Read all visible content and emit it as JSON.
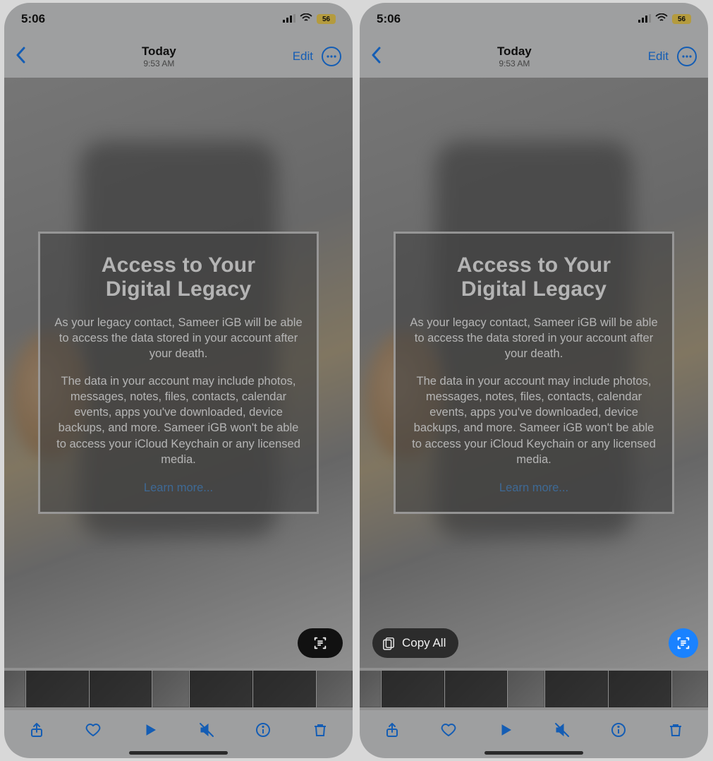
{
  "status": {
    "time": "5:06",
    "battery": "56"
  },
  "nav": {
    "day": "Today",
    "time": "9:53 AM",
    "edit": "Edit"
  },
  "legacy": {
    "title_l1": "Access to Your",
    "title_l2": "Digital Legacy",
    "p1": "As your legacy contact, Sameer iGB will be able to access the data stored in your account after your death.",
    "p2": "The data in your account may include photos, messages, notes, files, contacts, calendar events, apps you've downloaded, device backups, and more. Sameer iGB won't be able to access your iCloud Keychain or any licensed media.",
    "learn": "Learn more..."
  },
  "copy_all": "Copy All"
}
